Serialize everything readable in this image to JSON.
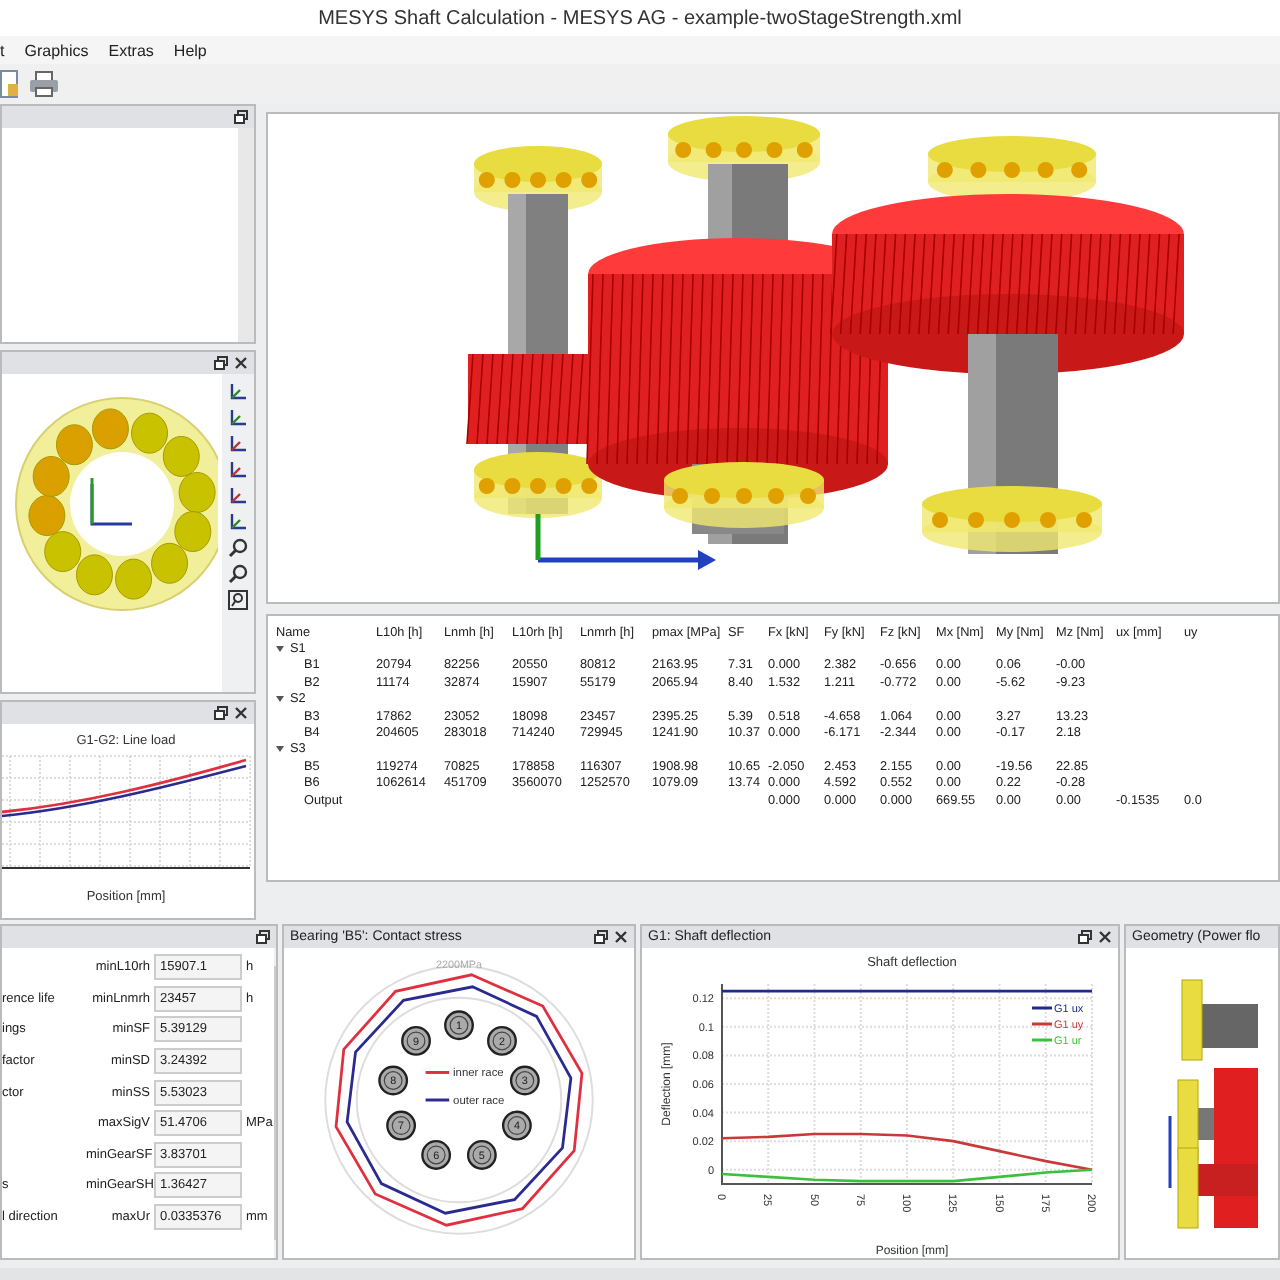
{
  "window": {
    "title": "MESYS Shaft Calculation - MESYS AG - example-twoStageStrength.xml"
  },
  "menu": [
    "t",
    "Graphics",
    "Extras",
    "Help"
  ],
  "line_load": {
    "title": "G1-G2: Line load",
    "xlabel": "Position [mm]"
  },
  "table": {
    "columns": [
      "Name",
      "L10h [h]",
      "Lnmh [h]",
      "L10rh [h]",
      "Lnmrh [h]",
      "pmax [MPa]",
      "SF",
      "Fx [kN]",
      "Fy [kN]",
      "Fz [kN]",
      "Mx [Nm]",
      "My [Nm]",
      "Mz [Nm]",
      "ux [mm]",
      "uy"
    ],
    "groups": [
      {
        "name": "S1",
        "expanded": true,
        "rows": [
          {
            "name": "B1",
            "cells": [
              "20794",
              "82256",
              "20550",
              "80812",
              "2163.95",
              "7.31",
              "0.000",
              "2.382",
              "-0.656",
              "0.00",
              "0.06",
              "-0.00"
            ]
          },
          {
            "name": "B2",
            "cells": [
              "11174",
              "32874",
              "15907",
              "55179",
              "2065.94",
              "8.40",
              "1.532",
              "1.211",
              "-0.772",
              "0.00",
              "-5.62",
              "-9.23"
            ]
          }
        ]
      },
      {
        "name": "S2",
        "expanded": true,
        "rows": [
          {
            "name": "B3",
            "cells": [
              "17862",
              "23052",
              "18098",
              "23457",
              "2395.25",
              "5.39",
              "0.518",
              "-4.658",
              "1.064",
              "0.00",
              "3.27",
              "13.23"
            ]
          },
          {
            "name": "B4",
            "cells": [
              "204605",
              "283018",
              "714240",
              "729945",
              "1241.90",
              "10.37",
              "0.000",
              "-6.171",
              "-2.344",
              "0.00",
              "-0.17",
              "2.18"
            ]
          }
        ]
      },
      {
        "name": "S3",
        "expanded": true,
        "rows": [
          {
            "name": "B5",
            "cells": [
              "119274",
              "70825",
              "178858",
              "116307",
              "1908.98",
              "10.65",
              "-2.050",
              "2.453",
              "2.155",
              "0.00",
              "-19.56",
              "22.85"
            ]
          },
          {
            "name": "B6",
            "cells": [
              "1062614",
              "451709",
              "3560070",
              "1252570",
              "1079.09",
              "13.74",
              "0.000",
              "4.592",
              "0.552",
              "0.00",
              "0.22",
              "-0.28"
            ]
          },
          {
            "name": "Output",
            "cells": [
              null,
              null,
              null,
              null,
              null,
              null,
              "0.000",
              "0.000",
              "0.000",
              "669.55",
              "0.00",
              "0.00",
              "-0.1535",
              "0.0"
            ]
          }
        ]
      }
    ]
  },
  "results": [
    {
      "key": "minL10rh",
      "value": "15907.1",
      "unit": "h"
    },
    {
      "label": "rence life",
      "key": "minLnmrh",
      "value": "23457",
      "unit": "h"
    },
    {
      "label": "ings",
      "key": "minSF",
      "value": "5.39129"
    },
    {
      "label": "factor",
      "key": "minSD",
      "value": "3.24392"
    },
    {
      "label": "ctor",
      "key": "minSS",
      "value": "5.53023"
    },
    {
      "key": "maxSigV",
      "value": "51.4706",
      "unit": "MPa"
    },
    {
      "key": "minGearSF",
      "value": "3.83701"
    },
    {
      "label": "s",
      "key": "minGearSH",
      "value": "1.36427"
    },
    {
      "label": "l direction",
      "key": "maxUr",
      "value": "0.0335376",
      "unit": "mm"
    }
  ],
  "contact_stress": {
    "title": "Bearing 'B5': Contact stress",
    "scale_label": "2200MPa",
    "balls": [
      "1",
      "2",
      "3",
      "4",
      "5",
      "6",
      "7",
      "8",
      "9"
    ],
    "legend": [
      {
        "name": "inner race",
        "color": "#e03040"
      },
      {
        "name": "outer race",
        "color": "#2a2a90"
      }
    ]
  },
  "deflection": {
    "title": "G1: Shaft deflection",
    "chart_data": {
      "type": "line",
      "title": "Shaft deflection",
      "xlabel": "Position [mm]",
      "ylabel": "Deflection [mm]",
      "x": [
        0,
        25,
        50,
        75,
        100,
        125,
        150,
        175,
        200
      ],
      "grid": true,
      "legend": true,
      "xlim": [
        0,
        200
      ],
      "ylim": [
        -0.01,
        0.13
      ],
      "xticks": [
        0,
        25,
        50,
        75,
        100,
        125,
        150,
        175,
        200
      ],
      "yticks": [
        0,
        0.02,
        0.04,
        0.06,
        0.08,
        0.1,
        0.12
      ],
      "series": [
        {
          "name": "G1 ux",
          "color": "#1f2a8a",
          "values": [
            0.125,
            0.125,
            0.125,
            0.125,
            0.125,
            0.125,
            0.125,
            0.125,
            0.125
          ]
        },
        {
          "name": "G1 uy",
          "color": "#c83a3a",
          "values": [
            0.022,
            0.023,
            0.025,
            0.025,
            0.024,
            0.02,
            0.013,
            0.006,
            0
          ]
        },
        {
          "name": "G1 ur",
          "color": "#3cc03c",
          "values": [
            -0.003,
            -0.005,
            -0.007,
            -0.008,
            -0.008,
            -0.008,
            -0.005,
            -0.002,
            0
          ]
        }
      ]
    }
  },
  "geometry": {
    "title": "Geometry (Power flo"
  }
}
